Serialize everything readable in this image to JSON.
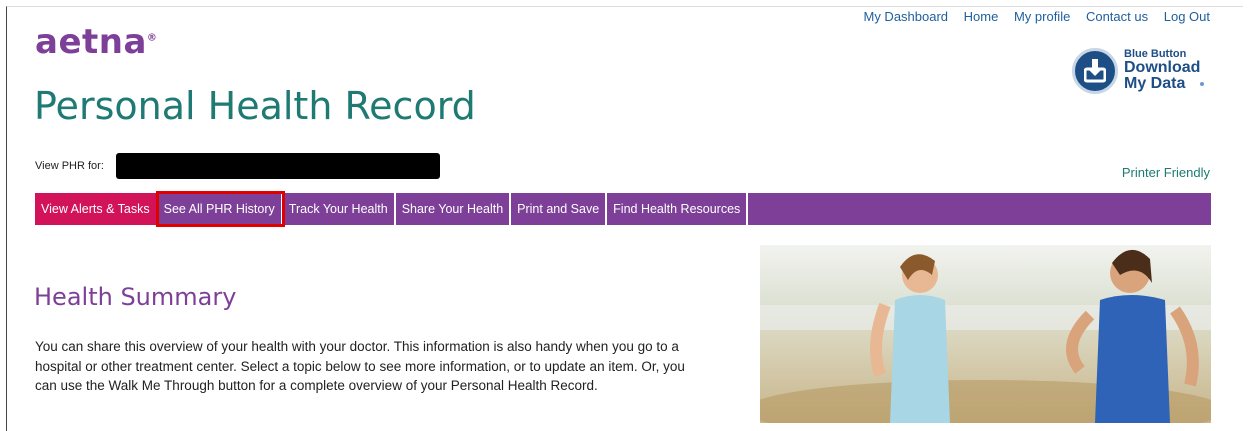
{
  "brand": {
    "logo_text": "aetna",
    "logo_mark": "®"
  },
  "header": {
    "top_links": [
      "My Dashboard",
      "Home",
      "My profile",
      "Contact us",
      "Log Out"
    ],
    "blue_button": {
      "small": "Blue Button",
      "line1": "Download",
      "line2": "My Data"
    },
    "page_title": "Personal Health Record"
  },
  "view_phr": {
    "label": "View PHR for:",
    "value": ""
  },
  "printer_friendly": "Printer Friendly",
  "nav": {
    "items": [
      {
        "label": "View Alerts & Tasks"
      },
      {
        "label": "See All PHR History"
      },
      {
        "label": "Track Your Health"
      },
      {
        "label": "Share Your Health"
      },
      {
        "label": "Print and Save"
      },
      {
        "label": "Find Health Resources"
      }
    ]
  },
  "main": {
    "section_title": "Health Summary",
    "description": "You can share this overview of your health with your doctor. This information is also handy when you go to a hospital or other treatment center. Select a topic below to see more information, or to update an item. Or, you can use the Walk Me Through button for a complete overview of your Personal Health Record."
  },
  "colors": {
    "brand_purple": "#7d3f98",
    "teal": "#1e7a72",
    "active_tab": "#d2135a",
    "highlight": "#e00000",
    "link_blue": "#1f5f9c"
  }
}
